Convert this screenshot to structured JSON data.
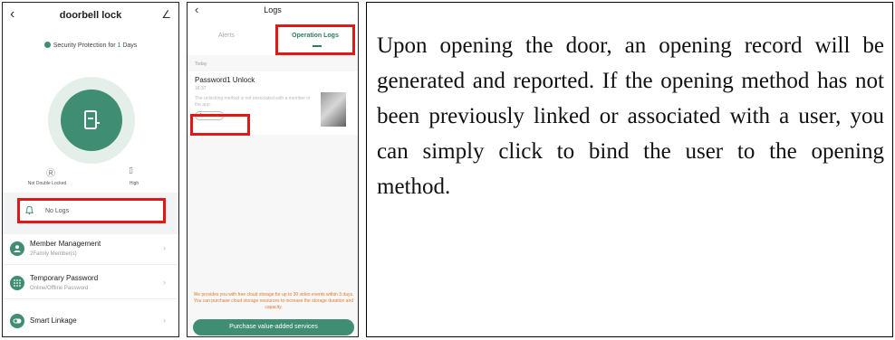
{
  "panel1": {
    "header": {
      "back_icon": "chevron-left-icon",
      "title": "doorbell lock",
      "edit_icon": "edit-icon"
    },
    "security": {
      "prefix": "Security Protection for ",
      "days": "1",
      "suffix": " Days"
    },
    "lock_icon": "door-lock-icon",
    "status": [
      {
        "icon": "double-lock-icon",
        "label": "Not Double Locked"
      },
      {
        "icon": "battery-icon",
        "label": "High"
      }
    ],
    "logs": {
      "icon": "bell-icon",
      "text": "No Logs"
    },
    "menu": [
      {
        "icon": "user-icon",
        "title": "Member Management",
        "subtitle": "2Family Member(s)"
      },
      {
        "icon": "keypad-icon",
        "title": "Temporary Password",
        "subtitle": "Online/Offline Password"
      },
      {
        "icon": "toggle-icon",
        "title": "Smart Linkage",
        "subtitle": ""
      }
    ],
    "colors": {
      "accent": "#3f8d73",
      "highlight": "#e01818"
    }
  },
  "panel2": {
    "header": {
      "back_icon": "chevron-left-icon",
      "title": "Logs"
    },
    "tabs": [
      "Alerts",
      "Operation Logs"
    ],
    "active_tab": "Operation Logs",
    "section": "Today",
    "entry": {
      "title": "Password1 Unlock",
      "time": "16:37",
      "description": "The unlocking method is not associated with a member in the app.",
      "action": "Associa..."
    },
    "promo": "We provides you with free cloud storage for up to 30 video events within 3 days. You can purchase cloud storage resources to increase the storage duration and capacity.",
    "purchase_button": "Purchase value-added services"
  },
  "panel3": {
    "text": "Upon opening the door, an opening record will be generated and reported. If the opening method has not been previously linked or associated with a user, you can simply click to bind the user to the opening method."
  }
}
